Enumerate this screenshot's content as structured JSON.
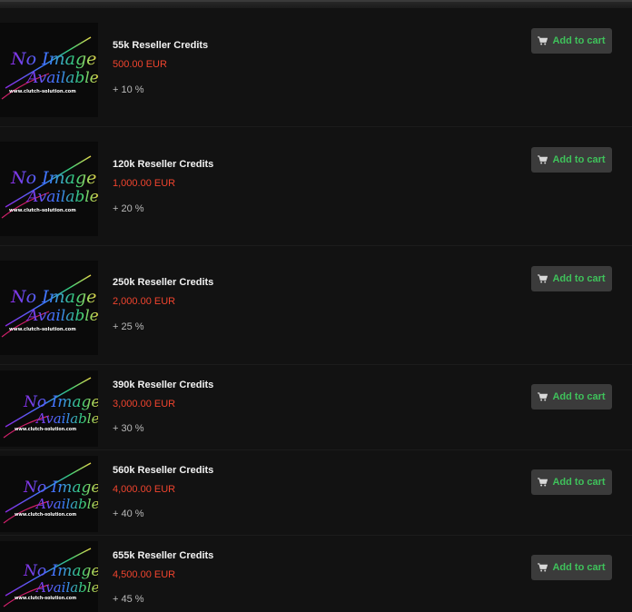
{
  "image_placeholder": {
    "line1": "No Image",
    "line2": "Available",
    "url": "www.clutch-solution.com"
  },
  "cart_label": "Add to cart",
  "colors": {
    "background": "#121212",
    "price": "#f0442e",
    "button_bg": "#3b3b3b",
    "button_text": "#3fc25b"
  },
  "products": [
    {
      "name": "55k Reseller Credits",
      "price": "500.00 EUR",
      "bonus": "+ 10 %"
    },
    {
      "name": "120k Reseller Credits",
      "price": "1,000.00 EUR",
      "bonus": "+ 20 %"
    },
    {
      "name": "250k Reseller Credits",
      "price": "2,000.00 EUR",
      "bonus": "+ 25 %"
    },
    {
      "name": "390k Reseller Credits",
      "price": "3,000.00 EUR",
      "bonus": "+ 30 %"
    },
    {
      "name": "560k Reseller Credits",
      "price": "4,000.00 EUR",
      "bonus": "+ 40 %"
    },
    {
      "name": "655k Reseller Credits",
      "price": "4,500.00 EUR",
      "bonus": "+ 45 %"
    }
  ]
}
